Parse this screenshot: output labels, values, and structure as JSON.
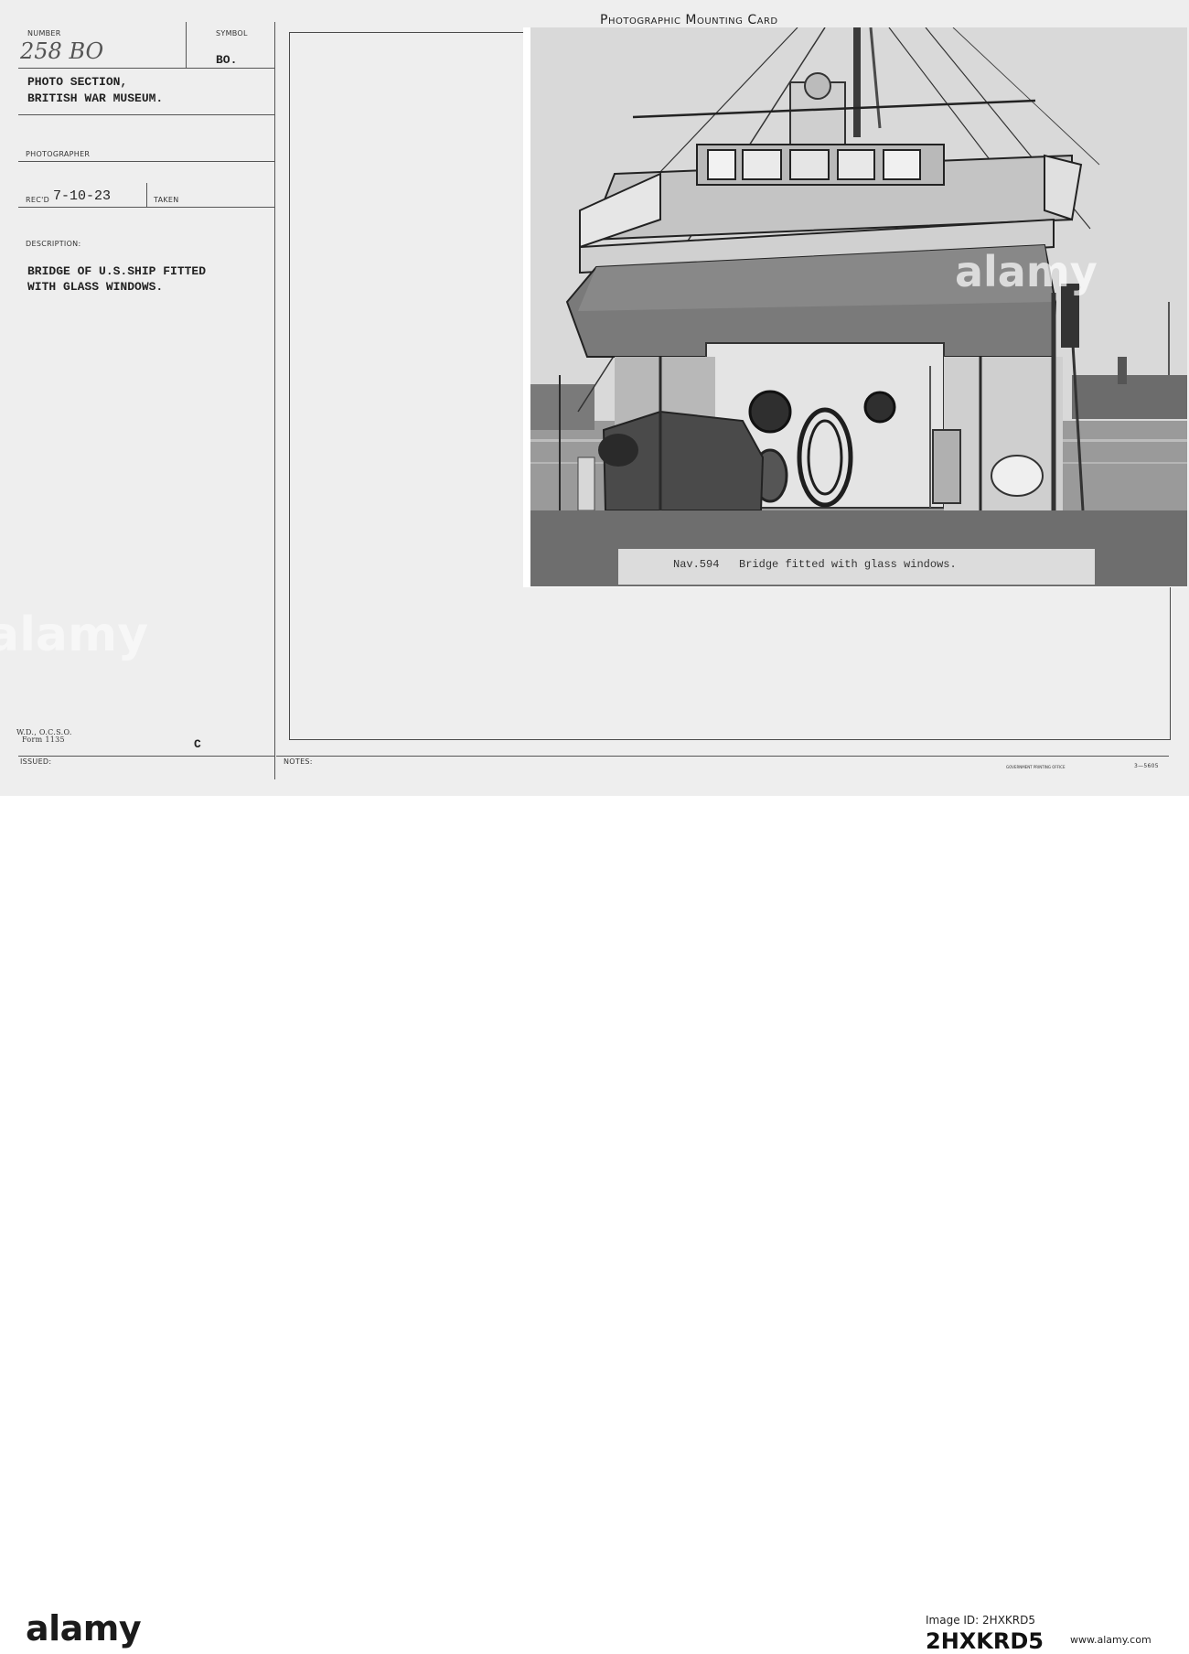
{
  "card": {
    "title": "Photographic Mounting Card",
    "labels": {
      "number": "NUMBER",
      "symbol": "SYMBOL",
      "photographer": "PHOTOGRAPHER",
      "recd": "REC'D",
      "taken": "TAKEN",
      "description": "DESCRIPTION:",
      "issued": "ISSUED:",
      "notes": "NOTES:"
    },
    "number_value": "258 BO",
    "symbol_value": "BO.",
    "section_line1": "PHOTO SECTION,",
    "section_line2": "BRITISH WAR MUSEUM.",
    "recd_value": "7-10-23",
    "description_line1": "BRIDGE OF U.S.SHIP FITTED",
    "description_line2": "WITH GLASS WINDOWS.",
    "form_line1": "W.D., O.C.S.O.",
    "form_line2": "Form 1135",
    "mark_c": "C",
    "printing_office": "GOVERNMENT PRINTING OFFICE",
    "print_code": "3—5605"
  },
  "photo": {
    "caption_number": "Nav.594",
    "caption_text": "Bridge fitted with glass windows."
  },
  "stock_footer": {
    "wordmark": "alamy",
    "image_id_label": "Image ID: 2HXKRD5",
    "image_id": "2HXKRD5",
    "url": "www.alamy.com"
  },
  "watermarks": [
    "alamy",
    "alamy"
  ]
}
